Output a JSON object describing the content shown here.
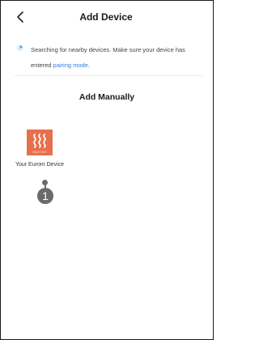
{
  "header": {
    "back_icon": "chevron-left-icon",
    "title": "Add Device"
  },
  "search": {
    "icon": "spinner-icon",
    "text_before": "Searching for nearby devices. Make sure your device has entered ",
    "link_label": "pairing mode",
    "text_after": "."
  },
  "manual": {
    "title": "Add Manually",
    "devices": [
      {
        "icon": "heating-icon",
        "icon_label": "HEATING",
        "name": "Your Eurom Device",
        "icon_color": "#e8704d"
      }
    ]
  },
  "callout": {
    "number": "1",
    "color": "#6b6b6b"
  },
  "colors": {
    "accent_link": "#2d7fe0",
    "spinner": "#5aa9e6"
  }
}
